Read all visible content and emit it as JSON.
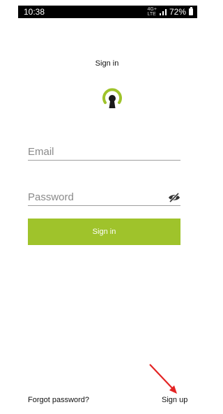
{
  "status_bar": {
    "time": "10:38",
    "network": "4G+",
    "signal_label": "LTE",
    "battery": "72%"
  },
  "page": {
    "title": "Sign in"
  },
  "form": {
    "email_placeholder": "Email",
    "password_placeholder": "Password",
    "signin_label": "Sign in"
  },
  "footer": {
    "forgot_label": "Forgot password?",
    "signup_label": "Sign up"
  },
  "colors": {
    "accent": "#9fc32b",
    "logo_dark": "#1a1a1a",
    "annotation_arrow": "#e32424"
  },
  "icons": {
    "logo": "keyhole-logo-icon",
    "password_toggle": "eye-off-icon",
    "annotation": "red-arrow-icon"
  }
}
